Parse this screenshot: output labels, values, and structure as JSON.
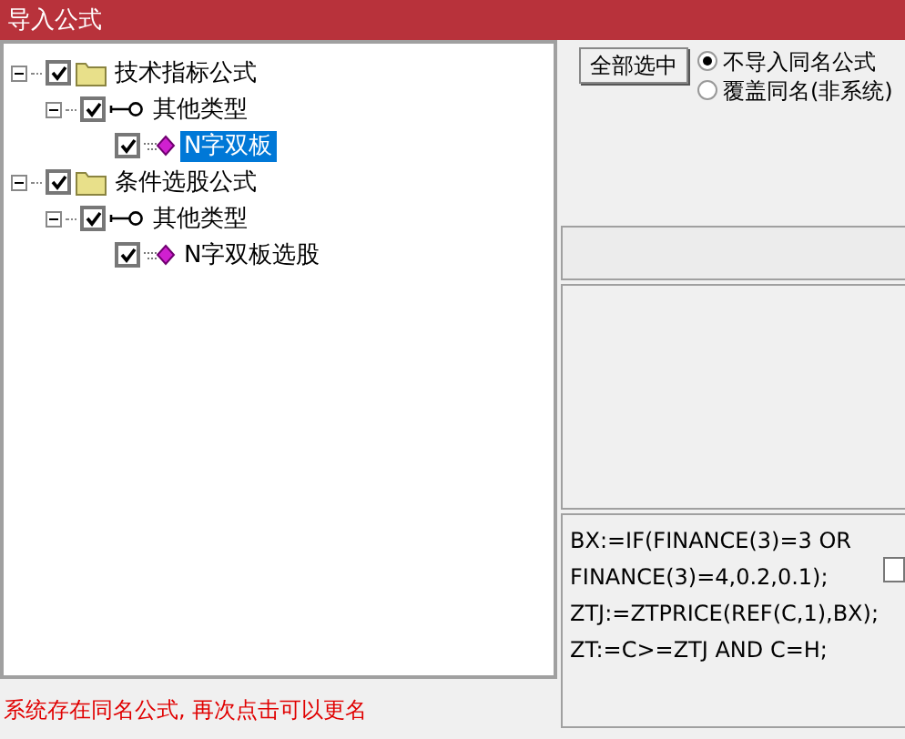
{
  "window": {
    "title": "导入公式"
  },
  "tree": [
    {
      "kind": "folder",
      "label": "技术指标公式",
      "checked": true,
      "expanded": true,
      "selected": false,
      "children": [
        {
          "kind": "type",
          "label": "其他类型",
          "checked": true,
          "expanded": true,
          "selected": false,
          "children": [
            {
              "kind": "formula",
              "label": "N字双板",
              "checked": true,
              "selected": true
            }
          ]
        }
      ]
    },
    {
      "kind": "folder",
      "label": "条件选股公式",
      "checked": true,
      "expanded": true,
      "selected": false,
      "children": [
        {
          "kind": "type",
          "label": "其他类型",
          "checked": true,
          "expanded": true,
          "selected": false,
          "children": [
            {
              "kind": "formula",
              "label": "N字双板选股",
              "checked": true,
              "selected": false
            }
          ]
        }
      ]
    }
  ],
  "select_all_button": "全部选中",
  "options": [
    {
      "label": "不导入同名公式",
      "selected": true
    },
    {
      "label": "覆盖同名(非系统)",
      "selected": false
    }
  ],
  "source_lines": [
    "BX:=IF(FINANCE(3)=3 OR",
    "FINANCE(3)=4,0.2,0.1);",
    "ZTJ:=ZTPRICE(REF(C,1),BX);",
    "ZT:=C>=ZTJ AND C=H;"
  ],
  "source_checkbox": {
    "checked": false
  },
  "status_message": "系统存在同名公式, 再次点击可以更名"
}
